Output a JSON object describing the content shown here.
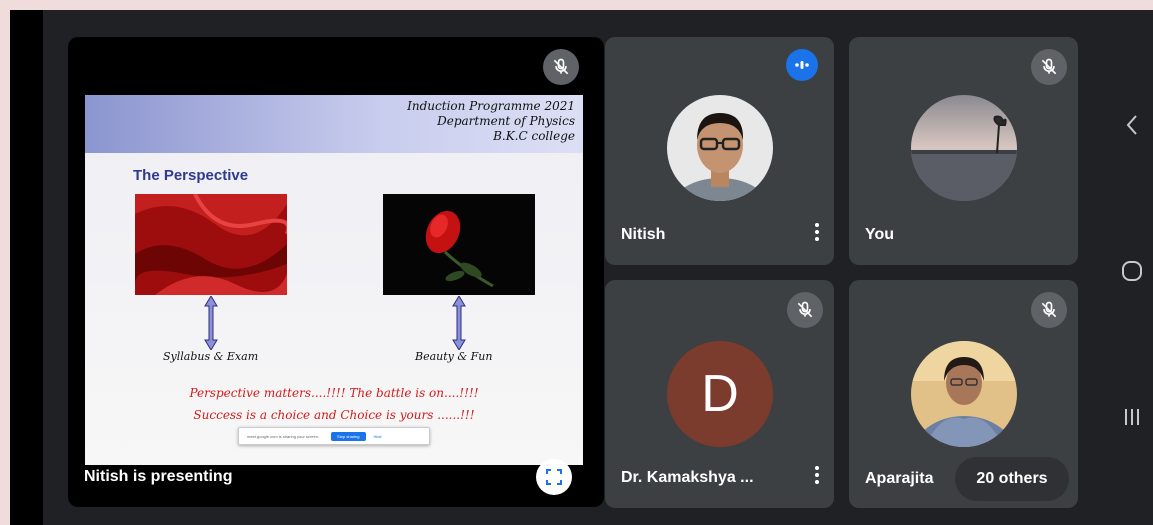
{
  "presentation": {
    "presenter_label": "Nitish is presenting",
    "slide": {
      "header_lines": [
        "Induction Programme 2021",
        "Department of Physics",
        "B.K.C college"
      ],
      "title": "The Perspective",
      "left_caption": "Syllabus & Exam",
      "right_caption": "Beauty & Fun",
      "line1": "Perspective matters....!!!! The battle is on....!!!!",
      "line2": "Success is a choice and Choice is yours ......!!!",
      "share_bar": {
        "text": "meet.google.com is sharing your screen.",
        "stop_label": "Stop sharing",
        "hide_label": "Hide"
      }
    }
  },
  "participants": [
    {
      "name": "Nitish",
      "status": "speaking"
    },
    {
      "name": "You",
      "status": "muted"
    },
    {
      "name": "Dr. Kamakshya ...",
      "status": "muted",
      "initial": "D"
    },
    {
      "name": "Aparajita",
      "status": "muted"
    }
  ],
  "others_label": "20 others",
  "colors": {
    "tile_bg": "#3c4043",
    "speaking_blue": "#1a73e8",
    "avatar_d": "#7b3b2d",
    "slide_red_text": "#d31b1b",
    "slide_title": "#2f3a8f"
  },
  "nav_icons": [
    "back-icon",
    "home-icon",
    "recents-icon"
  ]
}
